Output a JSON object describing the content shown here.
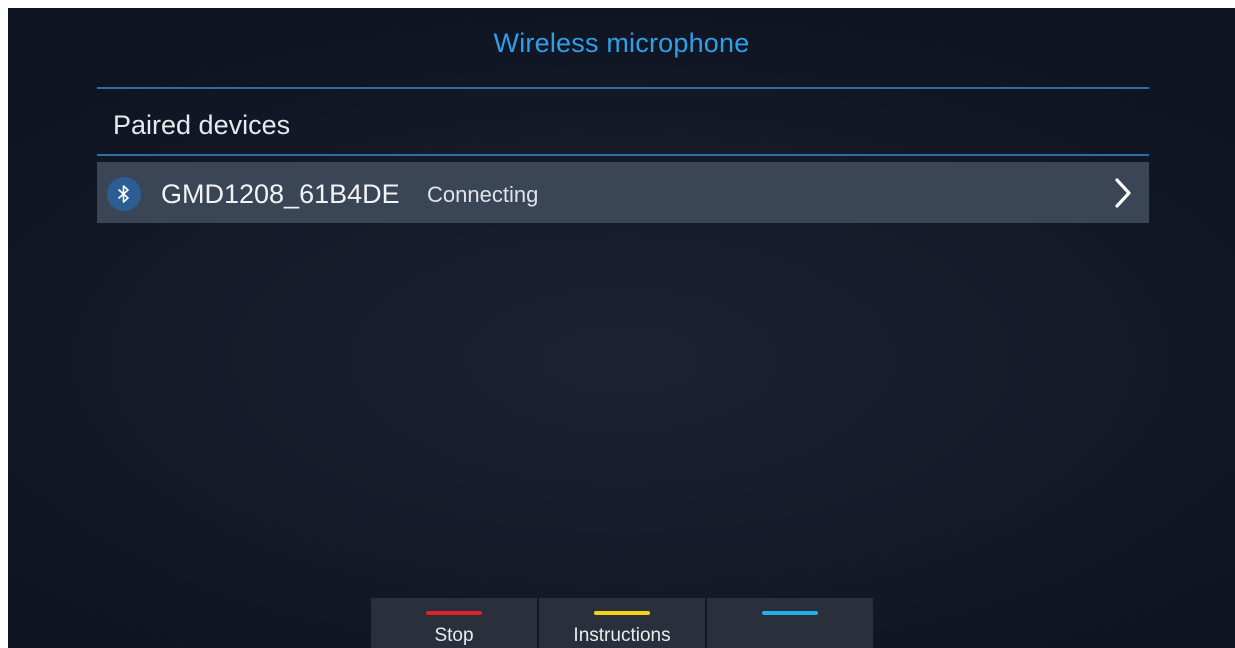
{
  "header": {
    "title": "Wireless microphone"
  },
  "section": {
    "label": "Paired devices"
  },
  "devices": [
    {
      "name": "GMD1208_61B4DE",
      "status": "Connecting",
      "icon": "bluetooth-icon"
    }
  ],
  "softkeys": [
    {
      "label": "Stop",
      "color": "#e0202a"
    },
    {
      "label": "Instructions",
      "color": "#f2d21a"
    },
    {
      "label": "",
      "color": "#1fb0e6"
    }
  ],
  "colors": {
    "accent": "#2f9fea",
    "divider": "#2b6fa8",
    "row_background": "#3a4555"
  }
}
